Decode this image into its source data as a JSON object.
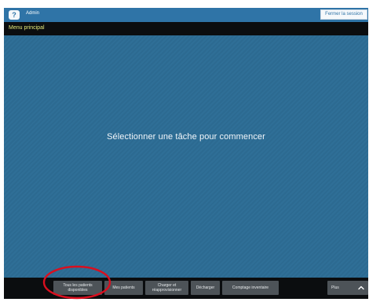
{
  "header": {
    "user": "Admin",
    "logout_label": "Fermer la session",
    "app_icon_symbol": "?"
  },
  "menu": {
    "title": "Menu principal"
  },
  "main": {
    "message": "Sélectionner une tâche pour commencer"
  },
  "footer": {
    "buttons": [
      {
        "line1": "Tous les patients",
        "line2": "disponibles"
      },
      {
        "label": "Mes patients"
      },
      {
        "line1": "Charger et",
        "line2": "réapprovisionner"
      },
      {
        "label": "Décharger"
      },
      {
        "label": "Comptage inventaire"
      }
    ],
    "more_label": "Plus"
  },
  "colors": {
    "accent_blue": "#2f74a7",
    "background_blue": "#2f6f97",
    "menu_text": "#e4ea7b",
    "button_gray": "#4d5358",
    "annotation_red": "#d90f1f"
  },
  "icons": {
    "app": "help-icon",
    "more": "chevron-up-icon"
  }
}
